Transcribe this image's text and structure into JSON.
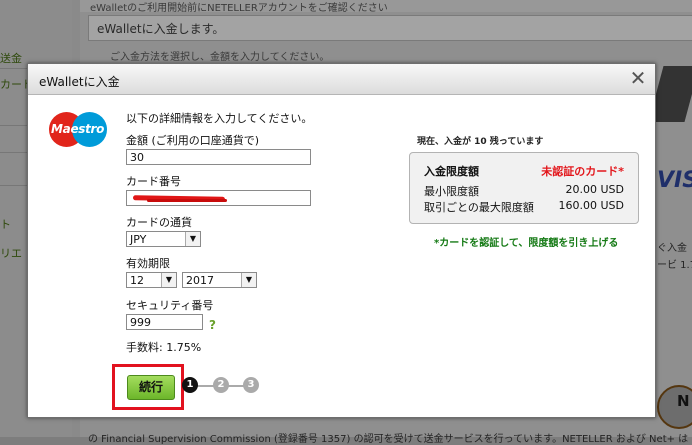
{
  "background": {
    "header": "eWalletに入金します。",
    "top_fragment": "eWalletのご利用開始前にNETELLERアカウントをご確認ください",
    "body_fragment": "ご入金方法を選択し、金額を入力してください。",
    "sidebar": [
      "送金",
      "カード",
      "ト",
      "リエ"
    ],
    "right_fragments": [
      "ぐ入金",
      "ービ 1.7"
    ],
    "brand_visa": "VISA",
    "brand_neteller": "N",
    "bottom_text": "の Financial Supervision Commission (登録番号 1357) の認可を受けて送金サービスを行っています。NETELLER および Net+ は"
  },
  "modal": {
    "title": "eWalletに入金",
    "close_icon": "close-icon",
    "logo": "Maestro",
    "instruction": "以下の詳細情報を入力してください。",
    "amount_label": "金額 (ご利用の口座通貨で)",
    "amount_value": "30",
    "card_number_label": "カード番号",
    "card_number_value": "",
    "currency_label": "カードの通貨",
    "currency_value": "JPY",
    "expiry_label": "有効期限",
    "expiry_month": "12",
    "expiry_year": "2017",
    "security_label": "セキュリティ番号",
    "security_value": "999",
    "help_link": "?",
    "fee_text": "手数料: 1.75%",
    "continue_label": "続行",
    "steps": [
      "1",
      "2",
      "3"
    ]
  },
  "limits": {
    "status": "現在、入金が 10 残っています",
    "heading": "入金限度額",
    "card_status": "未認証のカード*",
    "min_label": "最小限度額",
    "min_value": "20.00 USD",
    "max_label": "取引ごとの最大限度額",
    "max_value": "160.00 USD",
    "verify_link": "*カードを認証して、限度額を引き上げる"
  },
  "colors": {
    "accent_green": "#6cb62a",
    "highlight_red": "#e2121f",
    "unverified_red": "#e3161b",
    "link_green": "#157a15"
  }
}
